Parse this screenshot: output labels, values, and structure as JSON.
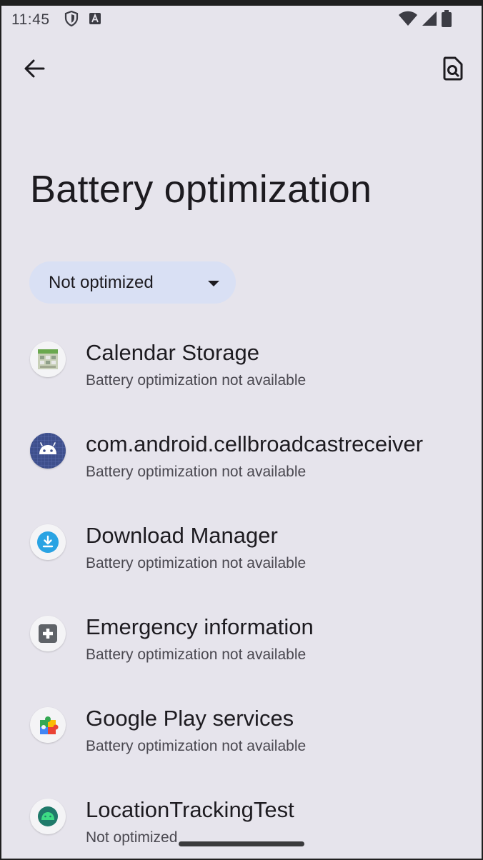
{
  "status_bar": {
    "time": "11:45",
    "left_icons": [
      "shield-icon",
      "keyboard-a-icon"
    ],
    "right_icons": [
      "wifi-icon",
      "cell-signal-icon",
      "battery-icon"
    ]
  },
  "app_bar": {
    "back_icon": "arrow-back-icon",
    "action_icon": "search-page-icon"
  },
  "page": {
    "title": "Battery optimization"
  },
  "filter": {
    "selected": "Not optimized"
  },
  "apps": [
    {
      "name": "Calendar Storage",
      "status": "Battery optimization not available",
      "icon": "calendar-storage-icon"
    },
    {
      "name": "com.android.cellbroadcastreceiver",
      "status": "Battery optimization not available",
      "icon": "android-default-icon"
    },
    {
      "name": "Download Manager",
      "status": "Battery optimization not available",
      "icon": "download-icon"
    },
    {
      "name": "Emergency information",
      "status": "Battery optimization not available",
      "icon": "medical-cross-icon"
    },
    {
      "name": "Google Play services",
      "status": "Battery optimization not available",
      "icon": "puzzle-icon"
    },
    {
      "name": "LocationTrackingTest",
      "status": "Not optimized",
      "icon": "android-test-icon"
    }
  ],
  "colors": {
    "background": "#e6e4ec",
    "chip": "#d9e0f4",
    "text_primary": "#1d1b20",
    "text_secondary": "#4a4850"
  }
}
